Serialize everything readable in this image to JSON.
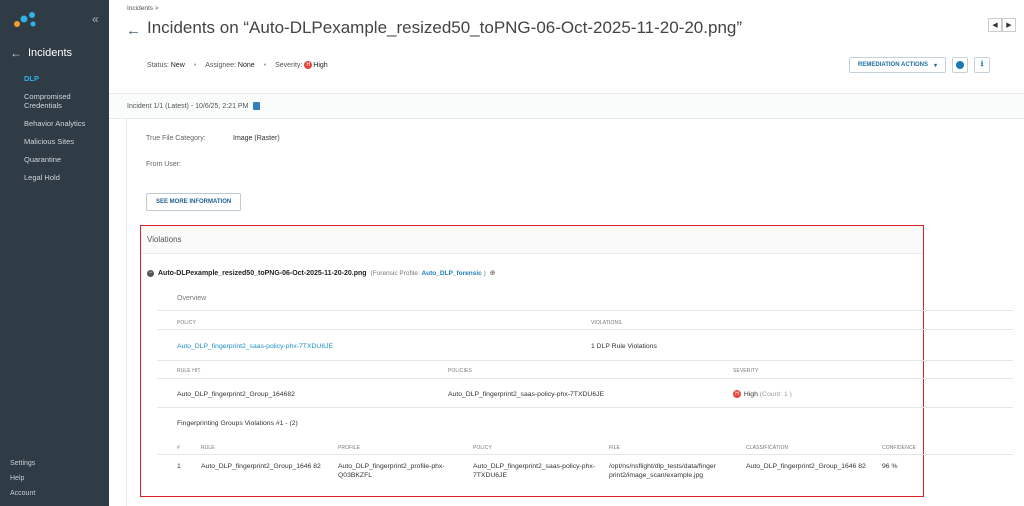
{
  "sidebar": {
    "section_title": "Incidents",
    "items": [
      {
        "label": "DLP",
        "active": true
      },
      {
        "label": "Compromised Credentials",
        "active": false
      },
      {
        "label": "Behavior Analytics",
        "active": false
      },
      {
        "label": "Malicious Sites",
        "active": false
      },
      {
        "label": "Quarantine",
        "active": false
      },
      {
        "label": "Legal Hold",
        "active": false
      }
    ],
    "bottom": [
      "Settings",
      "Help",
      "Account"
    ]
  },
  "header": {
    "breadcrumb": "Incidents >",
    "title": "Incidents on “Auto-DLPexample_resized50_toPNG-06-Oct-2025-11-20-20.png”",
    "status_label": "Status:",
    "status_value": "New",
    "assignee_label": "Assignee:",
    "assignee_value": "None",
    "severity_label": "Severity:",
    "severity_value": "High",
    "severity_icon_text": "H",
    "remediation_button": "REMEDIATION ACTIONS"
  },
  "incident_bar": {
    "text": "Incident 1/1 (Latest) - 10/6/25, 2:21 PM"
  },
  "info": {
    "true_file_category_label": "True File Category:",
    "true_file_category_value": "Image (Raster)",
    "from_user_label": "From User:",
    "see_more": "SEE MORE INFORMATION"
  },
  "violations": {
    "heading": "Violations",
    "file_name": "Auto-DLPexample_resized50_toPNG-06-Oct-2025-11-20-20.png",
    "forensic_prefix": "(Forensic Profile:",
    "forensic_profile": "Auto_DLP_forensic",
    "forensic_suffix": ")",
    "overview": "Overview",
    "policy_header": "POLICY",
    "violations_header": "VIOLATIONS",
    "policy_name": "Auto_DLP_fingerprint2_saas-policy-phx-7TXDU6JE",
    "violations_count": "1 DLP Rule Violations",
    "rulehit_header": "RULE HIT",
    "policies_header": "POLICIES",
    "severity_header": "SEVERITY",
    "rule_hit": "Auto_DLP_fingerprint2_Group_164682",
    "rule_policy": "Auto_DLP_fingerprint2_saas-policy-phx-7TXDU6JE",
    "severity": "High",
    "severity_icon_text": "H",
    "count": "(Count: 1 )",
    "group_title": "Fingerprinting Groups Violations #1 -  (2)",
    "group_headers": [
      "#",
      "RULE",
      "PROFILE",
      "POLICY",
      "FILE",
      "CLASSIFICATION",
      "CONFIDENCE"
    ],
    "group_row": {
      "num": "1",
      "rule": "Auto_DLP_fingerprint2_Group_1646 82",
      "profile": "Auto_DLP_fingerprint2_profile-phx-Q03BKZFL",
      "policy": "Auto_DLP_fingerprint2_saas-policy-phx-7TXDU6JE",
      "file": "/opt/ns/nsflight/dlp_tests/data/finger print2/image_scan/example.jpg",
      "classification": "Auto_DLP_fingerprint2_Group_1646 82",
      "confidence": "96 %"
    }
  },
  "colors": {
    "accent": "#1e8fc9",
    "sidebar": "#2f3b45",
    "danger": "#d8232a"
  }
}
